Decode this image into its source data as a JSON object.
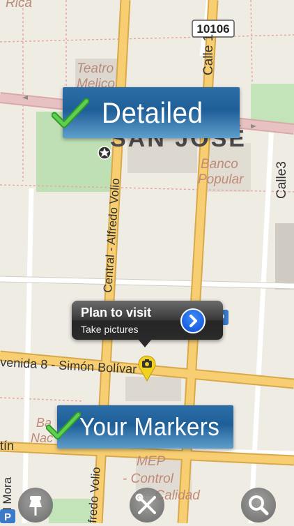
{
  "map": {
    "city_label": "SAN JOSÉ",
    "street_labels": {
      "central_alfredo_volio": "Central - Alfredo Volio",
      "calle_1": "Calle 1",
      "calle_3": "Calle3",
      "avenida_8": "venida 8 - Simón Bolívar",
      "del_mora": "del Mora",
      "fredo_volio": "fredo Volio",
      "rica": "Rica",
      "tin": "tín"
    },
    "route_shield": "10106",
    "poi_labels": {
      "teatro_melico": [
        "Teatro",
        "Melico"
      ],
      "banco_popular": [
        "Banco",
        "Popular"
      ],
      "ba_nac": [
        "Ba",
        "Nac"
      ],
      "mep": [
        "MEP",
        "- Control",
        "de Calidad"
      ]
    }
  },
  "banners": {
    "detailed": "Detailed",
    "your_markers": "Your Markers"
  },
  "callout": {
    "title": "Plan to visit",
    "subtitle": "Take pictures"
  },
  "toolbar": {
    "left_icon": "pushpin-icon",
    "center_icon": "tools-icon",
    "right_icon": "search-icon"
  },
  "colors": {
    "banner_blue": "#1f5f98",
    "road_yellow": "#f5c563",
    "road_red": "#d9a0a0",
    "park_green": "#b8dbb0",
    "check_green": "#3aa832",
    "callout_dark": "#2a2a2a",
    "disclosure_blue": "#1a5fe0"
  }
}
